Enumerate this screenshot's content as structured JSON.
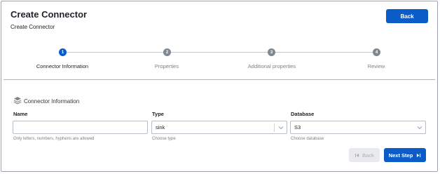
{
  "header": {
    "title": "Create Connector",
    "breadcrumb": "Create Connector",
    "back_label": "Back"
  },
  "stepper": {
    "steps": [
      {
        "number": "1",
        "label": "Connector Information",
        "active": true
      },
      {
        "number": "2",
        "label": "Properties",
        "active": false
      },
      {
        "number": "3",
        "label": "Additional properties",
        "active": false
      },
      {
        "number": "4",
        "label": "Review",
        "active": false
      }
    ]
  },
  "section": {
    "icon": "layers-icon",
    "title": "Connector Information"
  },
  "form": {
    "name": {
      "label": "Name",
      "value": "",
      "helper": "Only letters, numbers, hyphens are allowed"
    },
    "type": {
      "label": "Type",
      "value": "sink",
      "helper": "Choose type"
    },
    "database": {
      "label": "Database",
      "value": "S3",
      "helper": "Choose database"
    }
  },
  "footer": {
    "back_label": "Back",
    "next_label": "Next Step"
  },
  "colors": {
    "primary": "#0b5cc8",
    "inactive_step": "#7f8790",
    "disabled_bg": "#e8eaed"
  }
}
